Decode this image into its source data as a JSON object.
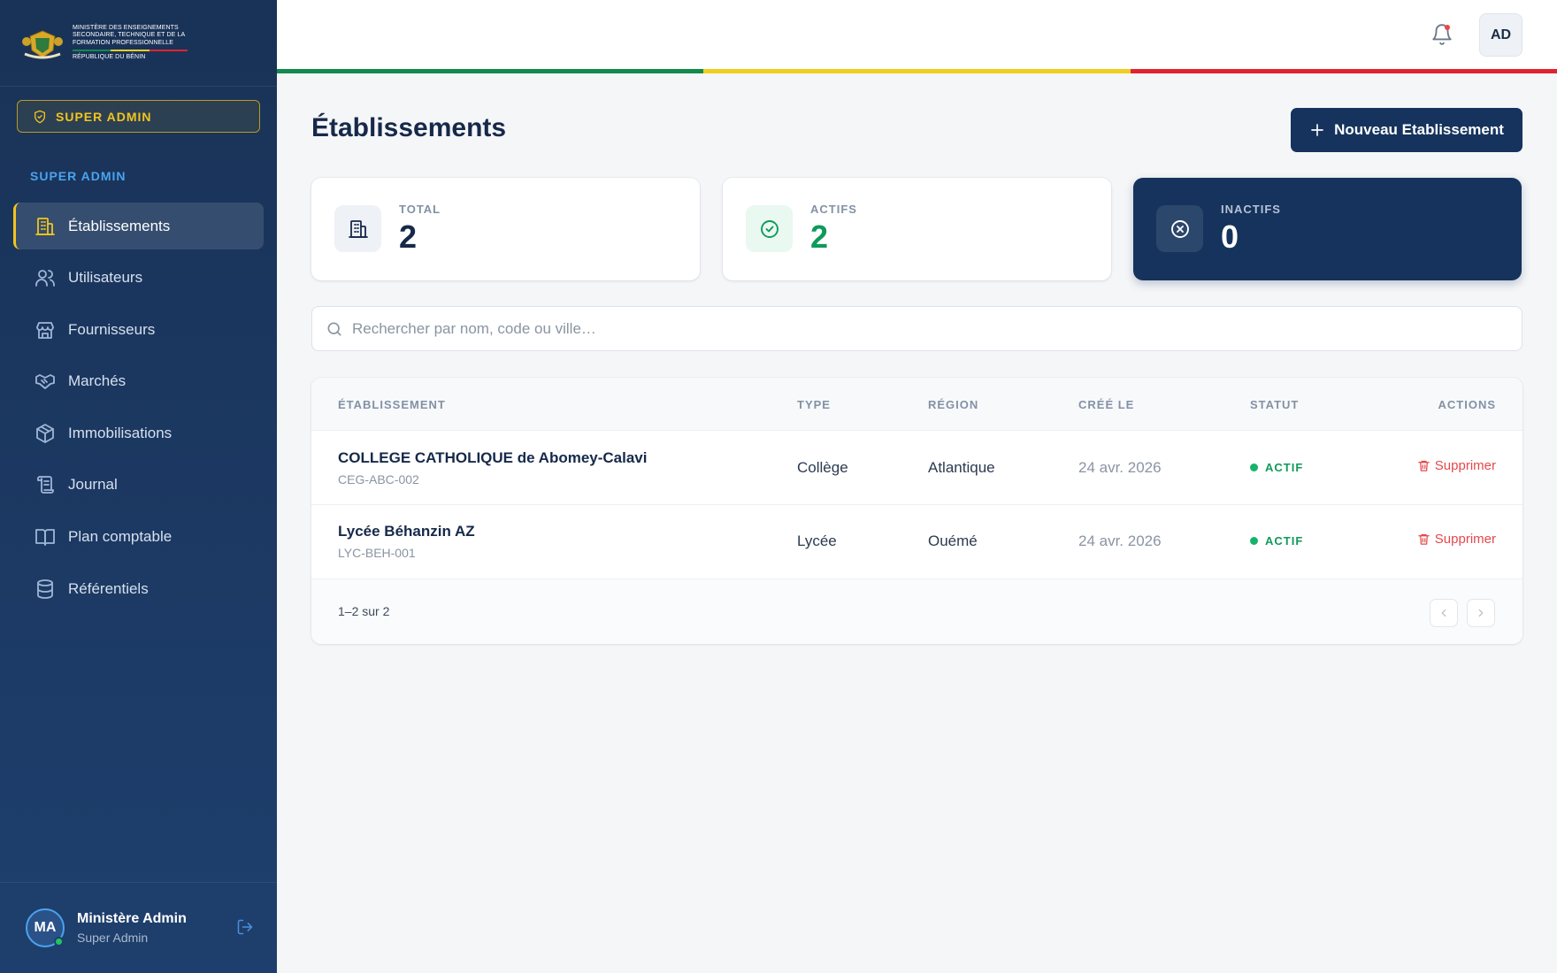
{
  "colors": {
    "green": "#118a4c",
    "yellow": "#f0ce1f",
    "red": "#e0242f",
    "accent": "#15335c"
  },
  "sidebar": {
    "logo_lines": [
      "MINISTÈRE DES ENSEIGNEMENTS",
      "SECONDAIRE, TECHNIQUE ET DE LA",
      "FORMATION PROFESSIONNELLE"
    ],
    "logo_country": "RÉPUBLIQUE DU BÉNIN",
    "role_badge": "SUPER ADMIN",
    "section_title": "SUPER ADMIN",
    "items": [
      {
        "label": "Établissements",
        "icon": "building-icon",
        "active": true
      },
      {
        "label": "Utilisateurs",
        "icon": "users-icon"
      },
      {
        "label": "Fournisseurs",
        "icon": "store-icon"
      },
      {
        "label": "Marchés",
        "icon": "handshake-icon"
      },
      {
        "label": "Immobilisations",
        "icon": "package-icon"
      },
      {
        "label": "Journal",
        "icon": "scroll-icon"
      },
      {
        "label": "Plan comptable",
        "icon": "book-icon"
      },
      {
        "label": "Référentiels",
        "icon": "database-icon"
      }
    ],
    "user": {
      "initials": "MA",
      "name": "Ministère Admin",
      "role": "Super Admin"
    }
  },
  "topbar": {
    "avatar_initials": "AD"
  },
  "main": {
    "title": "Établissements",
    "new_button": "Nouveau Etablissement",
    "stats": [
      {
        "label": "TOTAL",
        "value": "2"
      },
      {
        "label": "ACTIFS",
        "value": "2"
      },
      {
        "label": "INACTIFS",
        "value": "0"
      }
    ],
    "search_placeholder": "Rechercher par nom, code ou ville…",
    "table": {
      "headers": [
        "ÉTABLISSEMENT",
        "TYPE",
        "RÉGION",
        "CRÉÉ LE",
        "STATUT",
        "ACTIONS"
      ],
      "rows": [
        {
          "name": "COLLEGE CATHOLIQUE de Abomey-Calavi",
          "code": "CEG-ABC-002",
          "type": "Collège",
          "region": "Atlantique",
          "created": "24 avr. 2026",
          "status": "ACTIF",
          "action": "Supprimer"
        },
        {
          "name": "Lycée Béhanzin AZ",
          "code": "LYC-BEH-001",
          "type": "Lycée",
          "region": "Ouémé",
          "created": "24 avr. 2026",
          "status": "ACTIF",
          "action": "Supprimer"
        }
      ],
      "pagination": "1–2 sur 2"
    }
  }
}
